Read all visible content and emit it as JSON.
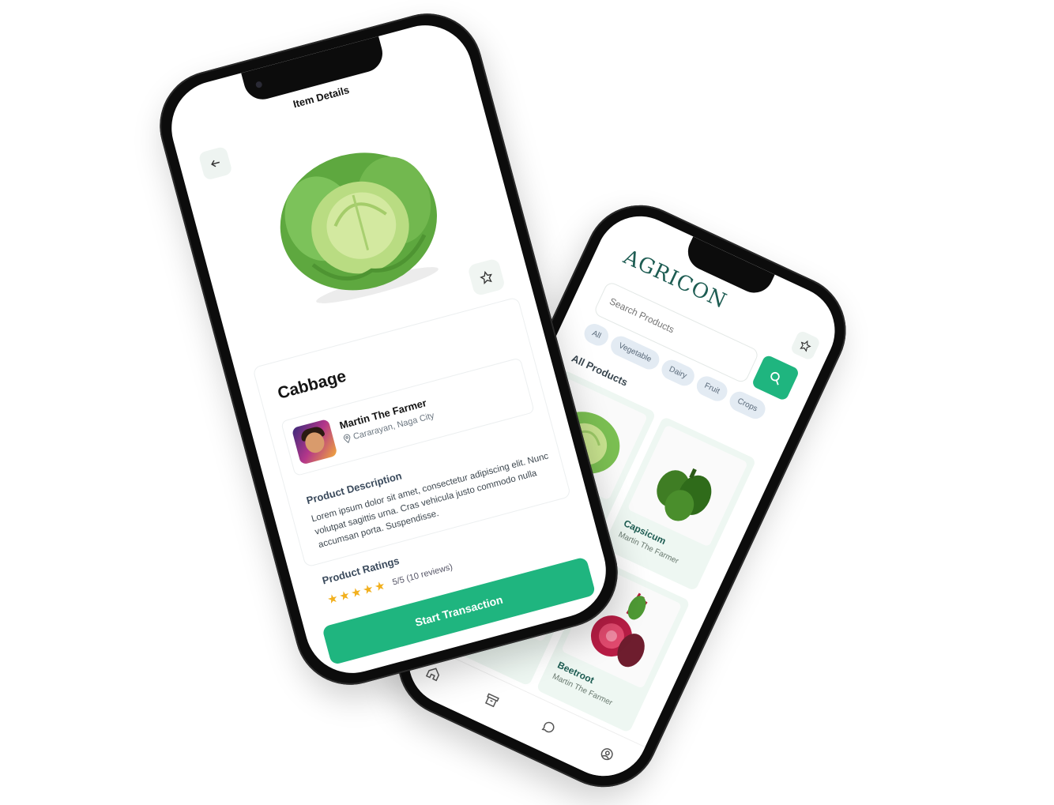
{
  "home": {
    "logo": "AGRICON",
    "search": {
      "placeholder": "Search Products"
    },
    "categories": [
      "All",
      "Vegetable",
      "Dairy",
      "Fruit",
      "Crops"
    ],
    "section_title": "All Products",
    "products": [
      {
        "name": "Capsicum",
        "seller": "Martin The Farmer"
      },
      {
        "name": "Beetroot",
        "seller": "Martin The Farmer"
      }
    ],
    "tabs": [
      "home-icon",
      "archive-icon",
      "chat-icon",
      "profile-icon"
    ]
  },
  "details": {
    "title": "Item Details",
    "product_name": "Cabbage",
    "seller": {
      "name": "Martin The Farmer",
      "location": "Cararayan, Naga City"
    },
    "description_title": "Product Description",
    "description": "Lorem ipsum dolor sit amet, consectetur adipiscing elit. Nunc volutpat sagittis urna. Cras vehicula justo commodo nulla accumsan porta. Suspendisse.",
    "ratings_title": "Product Ratings",
    "rating_stars": 5,
    "rating_text": "5/5 (10 reviews)",
    "cta": "Start Transaction"
  },
  "colors": {
    "accent": "#1fb57f",
    "brand": "#1d5c52",
    "star": "#f2b01e"
  }
}
